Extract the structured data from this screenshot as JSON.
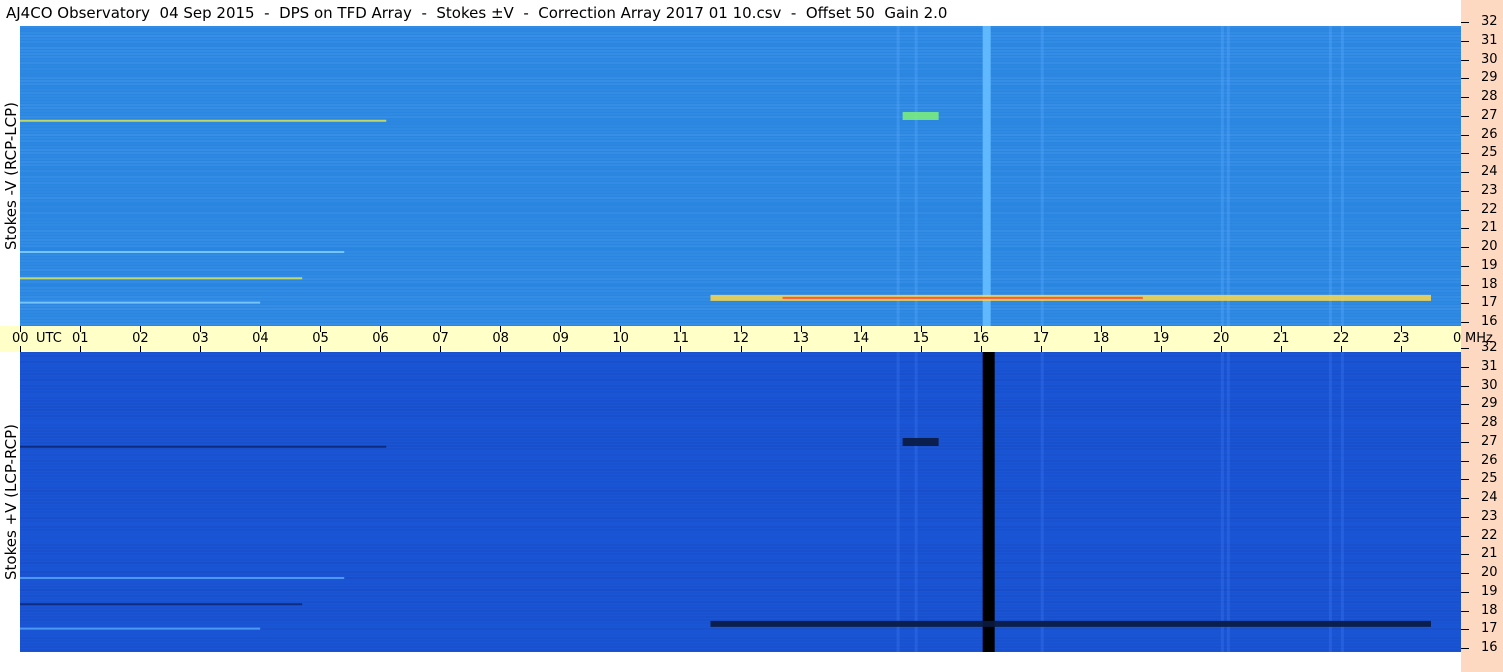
{
  "title": "AJ4CO Observatory  04 Sep 2015  -  DPS on TFD Array  -  Stokes ±V  -  Correction Array 2017 01 10.csv  -  Offset 50  Gain 2.0",
  "panels": {
    "top_label": "Stokes -V (RCP-LCP)",
    "bottom_label": "Stokes +V (LCP-RCP)"
  },
  "colors": {
    "top_background": "#2a86e0",
    "bottom_background": "#1a55d6",
    "time_axis_bg": "#ffffc8",
    "freq_axis_bg": "#fdd9c2"
  },
  "chart_data": [
    {
      "type": "heatmap",
      "title": "Stokes -V (RCP-LCP)",
      "x": {
        "unit": "UTC",
        "range": [
          0,
          24
        ],
        "tick_labels": [
          "00",
          "01",
          "02",
          "03",
          "04",
          "05",
          "06",
          "07",
          "08",
          "09",
          "10",
          "11",
          "12",
          "13",
          "14",
          "15",
          "16",
          "17",
          "18",
          "19",
          "20",
          "21",
          "22",
          "23",
          "00"
        ]
      },
      "y": {
        "unit": "MHz",
        "range": [
          16,
          32
        ],
        "tick_labels": [
          "32",
          "31",
          "30",
          "29",
          "28",
          "27",
          "26",
          "25",
          "24",
          "23",
          "22",
          "21",
          "20",
          "19",
          "18",
          "17",
          "16"
        ]
      },
      "features": [
        {
          "time": 16.1,
          "note": "vertical band (light)"
        },
        {
          "time_range": [
            11.5,
            23.5
          ],
          "freq": 17.5,
          "note": "horizontal interference band (yellow/red)"
        },
        {
          "time_range": [
            14.7,
            15.3
          ],
          "freq": 27.2,
          "note": "bright patch"
        }
      ]
    },
    {
      "type": "heatmap",
      "title": "Stokes +V (LCP-RCP)",
      "x": {
        "unit": "UTC",
        "range": [
          0,
          24
        ],
        "tick_labels": [
          "00",
          "01",
          "02",
          "03",
          "04",
          "05",
          "06",
          "07",
          "08",
          "09",
          "10",
          "11",
          "12",
          "13",
          "14",
          "15",
          "16",
          "17",
          "18",
          "19",
          "20",
          "21",
          "22",
          "23",
          "00"
        ]
      },
      "y": {
        "unit": "MHz",
        "range": [
          16,
          32
        ],
        "tick_labels": [
          "32",
          "31",
          "30",
          "29",
          "28",
          "27",
          "26",
          "25",
          "24",
          "23",
          "22",
          "21",
          "20",
          "19",
          "18",
          "17",
          "16"
        ]
      },
      "features": [
        {
          "time": 16.1,
          "note": "vertical band (black)"
        },
        {
          "time_range": [
            11.5,
            23.5
          ],
          "freq": 17.5,
          "note": "horizontal interference band (dark)"
        },
        {
          "time_range": [
            14.7,
            15.3
          ],
          "freq": 27.2,
          "note": "dark patch"
        }
      ]
    }
  ],
  "axis": {
    "utc_label": "UTC",
    "mhz_label": "MHz"
  }
}
